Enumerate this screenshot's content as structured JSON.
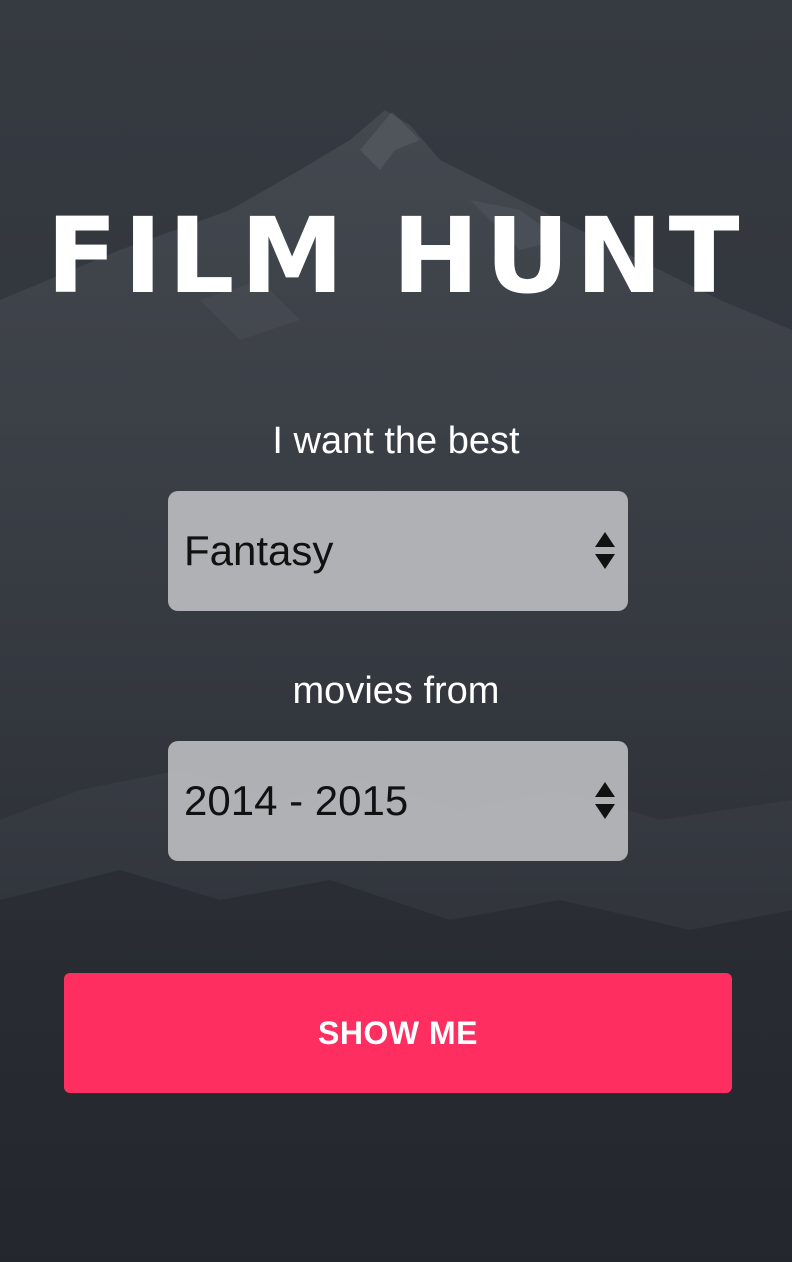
{
  "app": {
    "title": "FILM HUNT"
  },
  "form": {
    "genre_prompt": "I want the best",
    "genre_value": "Fantasy",
    "year_prompt": "movies from",
    "year_value": "2014 - 2015",
    "submit_label": "SHOW ME"
  },
  "colors": {
    "accent": "#fe2e60",
    "background": "#30343b",
    "select_fill": "#b3b4b6"
  },
  "icons": {
    "select_arrow": "up-down-arrows-icon",
    "background": "mountain-photo"
  }
}
